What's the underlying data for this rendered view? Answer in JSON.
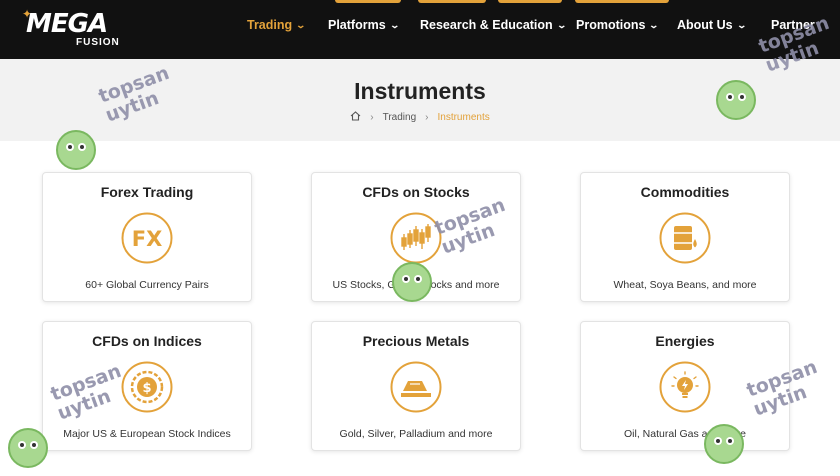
{
  "header": {
    "logo_text": "MEGA",
    "logo_subtext": "FUSION",
    "nav": [
      {
        "label": "Trading",
        "active": true,
        "has_dropdown": true
      },
      {
        "label": "Platforms",
        "active": false,
        "has_dropdown": true
      },
      {
        "label": "Research & Education",
        "active": false,
        "has_dropdown": true
      },
      {
        "label": "Promotions",
        "active": false,
        "has_dropdown": true
      },
      {
        "label": "About Us",
        "active": false,
        "has_dropdown": true
      },
      {
        "label": "Partner",
        "active": false,
        "has_dropdown": false
      }
    ]
  },
  "hero": {
    "title": "Instruments",
    "breadcrumb": [
      {
        "icon": "home-icon"
      },
      {
        "label": "Trading"
      },
      {
        "label": "Instruments",
        "current": true
      }
    ]
  },
  "instruments": [
    {
      "title": "Forex Trading",
      "description": "60+ Global Currency Pairs",
      "icon": "fx-icon"
    },
    {
      "title": "CFDs on Stocks",
      "description": "US Stocks, Global Stocks and more",
      "icon": "candlestick-icon"
    },
    {
      "title": "Commodities",
      "description": "Wheat, Soya Beans, and more",
      "icon": "oil-barrel-icon"
    },
    {
      "title": "CFDs on Indices",
      "description": "Major US & European Stock Indices",
      "icon": "dollar-coin-icon"
    },
    {
      "title": "Precious Metals",
      "description": "Gold, Silver, Palladium and more",
      "icon": "gold-bar-icon"
    },
    {
      "title": "Energies",
      "description": "Oil, Natural Gas and more",
      "icon": "lightbulb-icon"
    }
  ],
  "watermark": {
    "line1": "topsan",
    "line2": "uytin"
  },
  "colors": {
    "accent": "#e3a23a",
    "header_bg": "#111111",
    "hero_bg": "#f2f2f2"
  }
}
